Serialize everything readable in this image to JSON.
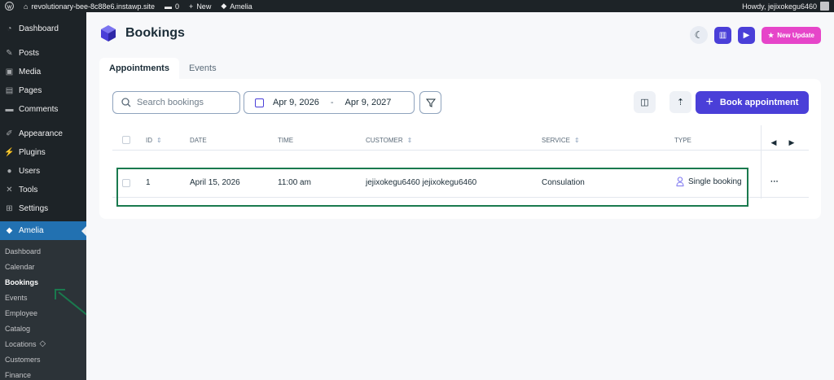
{
  "adminbar": {
    "site_name": "revolutionary-bee-8c88e6.instawp.site",
    "comments_count": "0",
    "new_label": "New",
    "plugin_label": "Amelia",
    "howdy": "Howdy, jejixokegu6460"
  },
  "sidebar": {
    "items": [
      {
        "label": "Dashboard",
        "icon": "dashboard-icon"
      },
      {
        "label": "Posts",
        "icon": "pin-icon"
      },
      {
        "label": "Media",
        "icon": "media-icon"
      },
      {
        "label": "Pages",
        "icon": "page-icon"
      },
      {
        "label": "Comments",
        "icon": "comment-icon"
      },
      {
        "label": "Appearance",
        "icon": "brush-icon"
      },
      {
        "label": "Plugins",
        "icon": "plugin-icon"
      },
      {
        "label": "Users",
        "icon": "user-icon"
      },
      {
        "label": "Tools",
        "icon": "wrench-icon"
      },
      {
        "label": "Settings",
        "icon": "settings-icon"
      }
    ],
    "current": {
      "label": "Amelia",
      "icon": "amelia-icon"
    },
    "submenu": [
      "Dashboard",
      "Calendar",
      "Bookings",
      "Events",
      "Employee",
      "Catalog",
      "Locations",
      "Customers",
      "Finance"
    ]
  },
  "page": {
    "title": "Bookings",
    "new_update_label": "New Update"
  },
  "tabs": [
    "Appointments",
    "Events"
  ],
  "toolbar": {
    "search_placeholder": "Search bookings",
    "date_from": "Apr 9, 2026",
    "date_to": "Apr 9, 2027",
    "book_label": "Book appointment"
  },
  "table": {
    "headers": [
      "ID",
      "DATE",
      "TIME",
      "CUSTOMER",
      "SERVICE",
      "TYPE"
    ],
    "rows": [
      {
        "id": "1",
        "date": "April 15, 2026",
        "time": "11:00 am",
        "customer": "jejixokegu6460 jejixokegu6460",
        "service": "Consulation",
        "type": "Single booking",
        "actions": "···"
      }
    ]
  },
  "colors": {
    "accent": "#4a3fd8",
    "highlight": "#1a7a4e",
    "new_update": "#e645c9"
  }
}
